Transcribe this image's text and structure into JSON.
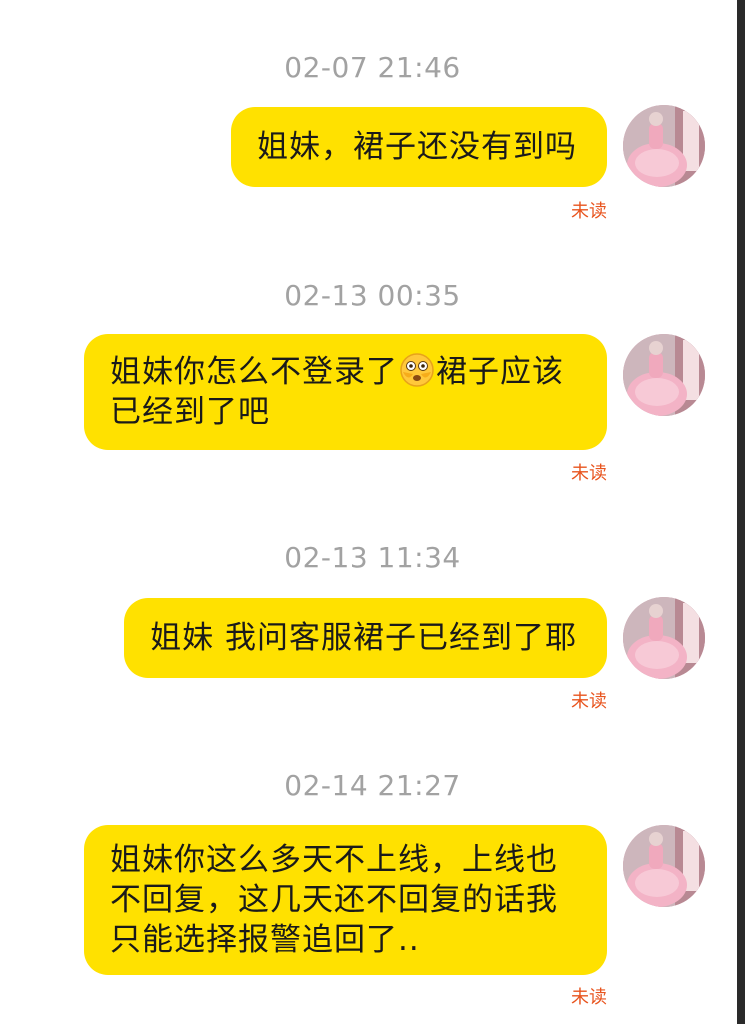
{
  "messages": [
    {
      "timestamp": "02-07 21:46",
      "lines": [
        "姐妹，裙子还没有到吗"
      ],
      "status": "未读"
    },
    {
      "timestamp": "02-13 00:35",
      "lines_rich": {
        "before_emoji": "姐妹你怎么不登录了",
        "emoji": "flushed-face",
        "after_emoji": "裙子应该",
        "line2": "已经到了吧"
      },
      "status": "未读"
    },
    {
      "timestamp": "02-13 11:34",
      "lines": [
        "姐妹 我问客服裙子已经到了耶"
      ],
      "status": "未读"
    },
    {
      "timestamp": "02-14 21:27",
      "lines": [
        "姐妹你这么多天不上线，上线也",
        "不回复，这几天还不回复的话我",
        "只能选择报警追回了.."
      ],
      "status": "未读"
    }
  ],
  "avatar_icon": "user-avatar-pink-dress",
  "colors": {
    "bubble": "#ffe100",
    "timestamp": "#a2a2a2",
    "unread": "#e8541e",
    "background": "#ffffff"
  }
}
